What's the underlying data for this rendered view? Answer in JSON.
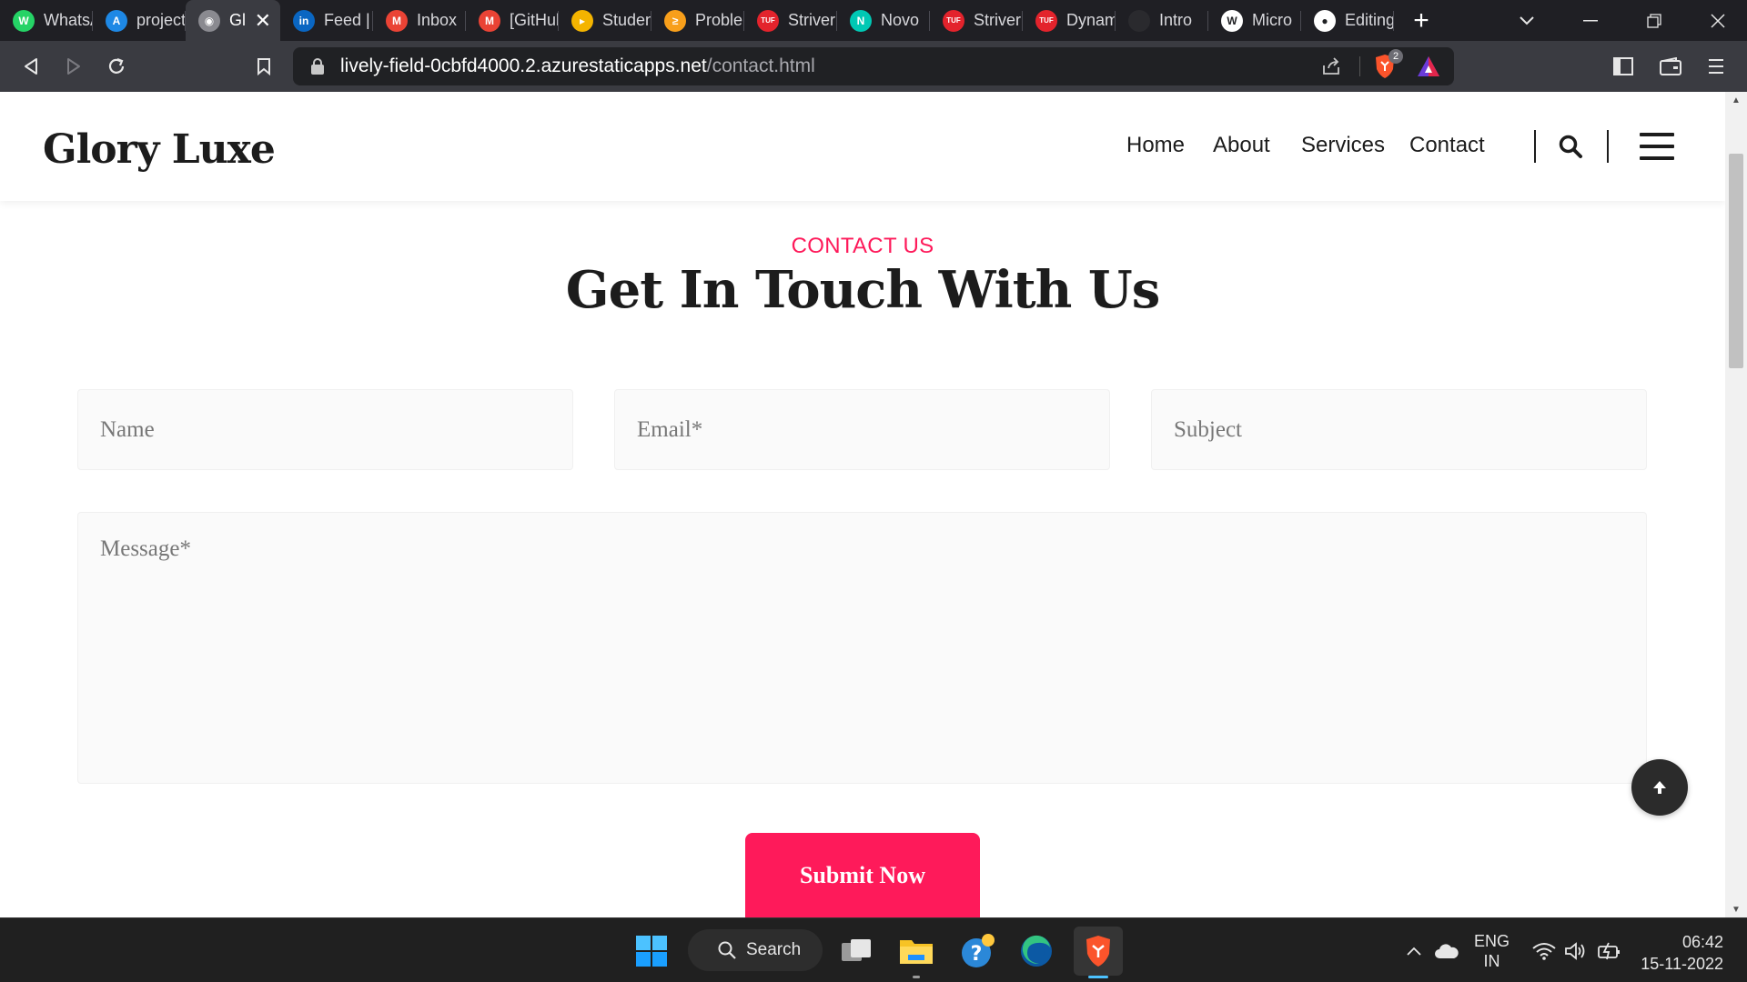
{
  "browser": {
    "tabs": [
      {
        "title": "WhatsApp",
        "icon": "whatsapp-icon",
        "color": "#25d366",
        "glyph": "W"
      },
      {
        "title": "projects",
        "icon": "azure-icon",
        "color": "#1e88e5",
        "glyph": "A"
      },
      {
        "title": "Glory Luxe",
        "icon": "globe-icon",
        "color": "#8a8a90",
        "glyph": "◉",
        "active": true
      },
      {
        "title": "Feed | LinkedIn",
        "icon": "linkedin-icon",
        "color": "#0a66c2",
        "glyph": "in"
      },
      {
        "title": "Inbox",
        "icon": "gmail-icon",
        "color": "#ea4335",
        "glyph": "M"
      },
      {
        "title": "[GitHub]",
        "icon": "gmail-icon",
        "color": "#ea4335",
        "glyph": "M"
      },
      {
        "title": "Student",
        "icon": "student-icon",
        "color": "#f4b400",
        "glyph": "▸"
      },
      {
        "title": "Problems",
        "icon": "problems-icon",
        "color": "#f89f1b",
        "glyph": "≥"
      },
      {
        "title": "Striver",
        "icon": "tuf-icon",
        "color": "#e3232c",
        "glyph": "TUF"
      },
      {
        "title": "Novo",
        "icon": "novo-icon",
        "color": "#00c8b4",
        "glyph": "N"
      },
      {
        "title": "Striver",
        "icon": "tuf-icon",
        "color": "#e3232c",
        "glyph": "TUF"
      },
      {
        "title": "Dynamic",
        "icon": "tuf-icon",
        "color": "#e3232c",
        "glyph": "TUF"
      },
      {
        "title": "Intro",
        "icon": "blank-icon",
        "color": "#2a2a2e",
        "glyph": ""
      },
      {
        "title": "Micro",
        "icon": "wordpress-icon",
        "color": "#ffffff",
        "glyph": "W"
      },
      {
        "title": "Editing",
        "icon": "github-icon",
        "color": "#ffffff",
        "glyph": "●"
      }
    ],
    "url_host": "lively-field-0cbfd4000.2.azurestaticapps.net",
    "url_path": "/contact.html",
    "shield_count": "2"
  },
  "site": {
    "logo": "Glory Luxe",
    "nav": [
      "Home",
      "About",
      "Services",
      "Contact"
    ],
    "eyebrow": "CONTACT US",
    "heading": "Get In Touch With Us",
    "form": {
      "name_placeholder": "Name",
      "email_placeholder": "Email*",
      "subject_placeholder": "Subject",
      "message_placeholder": "Message*",
      "submit_label": "Submit Now"
    },
    "accent_color": "#fe1a5a"
  },
  "taskbar": {
    "search_label": "Search",
    "lang_line1": "ENG",
    "lang_line2": "IN",
    "time": "06:42",
    "date": "15-11-2022"
  }
}
